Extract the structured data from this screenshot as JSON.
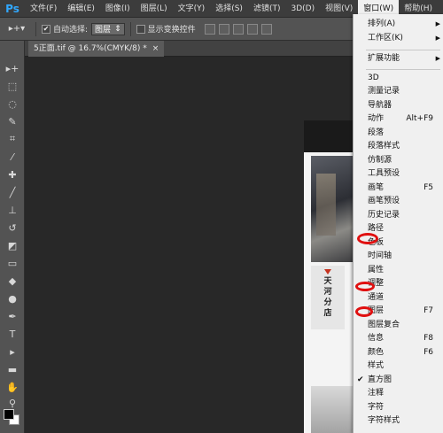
{
  "menubar": {
    "logo": "Ps",
    "items": [
      "文件(F)",
      "编辑(E)",
      "图像(I)",
      "图层(L)",
      "文字(Y)",
      "选择(S)",
      "滤镜(T)",
      "3D(D)",
      "视图(V)",
      "窗口(W)",
      "帮助(H)"
    ]
  },
  "optbar": {
    "auto_select_label": "自动选择:",
    "auto_select_value": "图层",
    "show_transform_label": "显示变换控件"
  },
  "doc_tab": {
    "title": "5正面.tif @ 16.7%(CMYK/8) *",
    "close": "×"
  },
  "doc": {
    "store_lines": [
      "天",
      "河",
      "分",
      "店"
    ]
  },
  "window_menu": {
    "items": [
      {
        "label": "排列(A)",
        "submenu": true
      },
      {
        "label": "工作区(K)",
        "submenu": true
      },
      {
        "label": "扩展功能",
        "submenu": true
      },
      {
        "label": "3D"
      },
      {
        "label": "测量记录"
      },
      {
        "label": "导航器"
      },
      {
        "label": "动作",
        "shortcut": "Alt+F9"
      },
      {
        "label": "段落"
      },
      {
        "label": "段落样式"
      },
      {
        "label": "仿制源"
      },
      {
        "label": "工具预设"
      },
      {
        "label": "画笔",
        "shortcut": "F5"
      },
      {
        "label": "画笔预设"
      },
      {
        "label": "历史记录"
      },
      {
        "label": "路径"
      },
      {
        "label": "色板"
      },
      {
        "label": "时间轴"
      },
      {
        "label": "属性"
      },
      {
        "label": "调整"
      },
      {
        "label": "通道"
      },
      {
        "label": "图层",
        "shortcut": "F7"
      },
      {
        "label": "图层复合"
      },
      {
        "label": "信息",
        "shortcut": "F8"
      },
      {
        "label": "颜色",
        "shortcut": "F6"
      },
      {
        "label": "样式"
      },
      {
        "label": "直方图",
        "checked": true
      },
      {
        "label": "注释"
      },
      {
        "label": "字符"
      },
      {
        "label": "字符样式"
      }
    ]
  },
  "colors": {
    "highlight_marks": "#e01010",
    "ps_blue": "#31a8ff"
  }
}
